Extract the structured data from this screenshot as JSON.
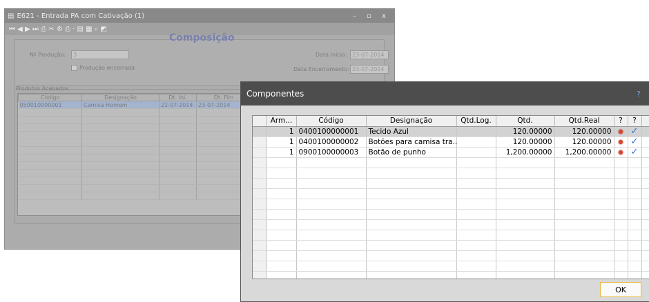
{
  "back_window": {
    "title": "E621 - Entrada PA com Cativação (1)",
    "window_controls": "– ▫ x",
    "toolbar_glyphs": "⏮ ◀ ▶ ⏭ ⎙ ✂ ⚙ ⎙ · ▤ ▦ ⌕ ◩",
    "production_label": "Nº Produção:",
    "production_value": "3",
    "closed_label": "Produção encerrada",
    "heading": "Composição",
    "start_label": "Data Início:",
    "start_value": "23-07-2014",
    "end_label": "Data Encerramento:",
    "end_value": "23-07-2014",
    "products_label": "Produtos Acabados",
    "columns": [
      "Código",
      "Designação",
      "Dt. Ini.",
      "Dt. Fim"
    ],
    "rows": [
      {
        "code": "050010000001",
        "designation": "Camisa Homem",
        "dt_ini": "22-07-2014",
        "dt_fim": "23-07-2014"
      }
    ]
  },
  "dialog": {
    "title": "Componentes",
    "help_icon": "?",
    "close_icon": "x",
    "columns": [
      "Arm...",
      "Código",
      "Designação",
      "Qtd.Log.",
      "Qtd.",
      "Qtd.Real",
      "?",
      "?"
    ],
    "rows": [
      {
        "arm": "1",
        "code": "0400100000001",
        "designation": "Tecido Azul",
        "qtd_log": "",
        "qtd": "120.00000",
        "qtd_real": "120.00000",
        "selected": true
      },
      {
        "arm": "1",
        "code": "0400100000002",
        "designation": "Botões para camisa tra...",
        "qtd_log": "",
        "qtd": "120.00000",
        "qtd_real": "120.00000",
        "selected": false
      },
      {
        "arm": "1",
        "code": "0900100000003",
        "designation": "Botão de punho",
        "qtd_log": "",
        "qtd": "1,200.00000",
        "qtd_real": "1,200.00000",
        "selected": false
      }
    ],
    "ok_label": "OK"
  }
}
